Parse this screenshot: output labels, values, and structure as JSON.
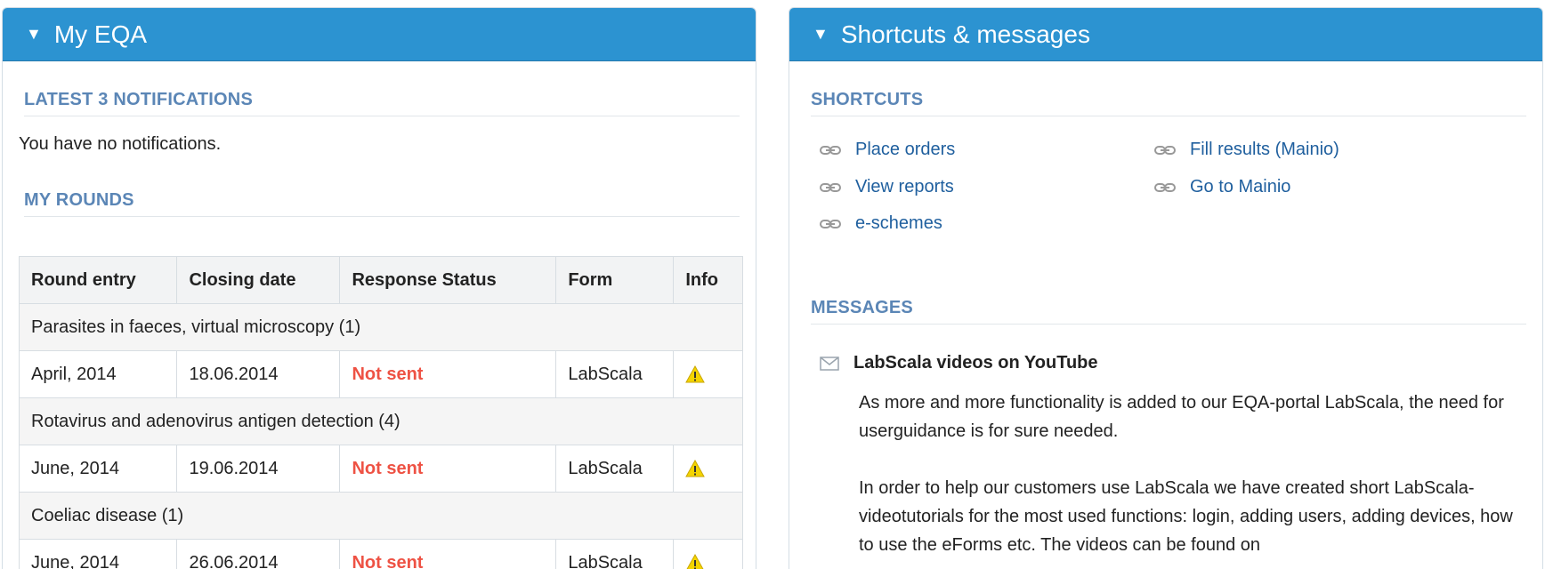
{
  "my_eqa": {
    "title": "My EQA",
    "notifications_heading": "LATEST 3 NOTIFICATIONS",
    "notifications_text": "You have no notifications.",
    "rounds_heading": "MY ROUNDS",
    "columns": [
      "Round entry",
      "Closing date",
      "Response Status",
      "Form",
      "Info"
    ],
    "groups": [
      {
        "name": "Parasites in faeces, virtual microscopy (1)",
        "round_entry": "April, 2014",
        "closing_date": "18.06.2014",
        "status": "Not sent",
        "form": "LabScala",
        "info_icon": "warning-icon"
      },
      {
        "name": "Rotavirus and adenovirus antigen detection (4)",
        "round_entry": "June, 2014",
        "closing_date": "19.06.2014",
        "status": "Not sent",
        "form": "LabScala",
        "info_icon": "warning-icon"
      },
      {
        "name": "Coeliac disease (1)",
        "round_entry": "June, 2014",
        "closing_date": "26.06.2014",
        "status": "Not sent",
        "form": "LabScala",
        "info_icon": "warning-icon"
      }
    ]
  },
  "shortcuts_panel": {
    "title": "Shortcuts & messages",
    "shortcuts_heading": "SHORTCUTS",
    "shortcuts": [
      "Place orders",
      "View reports",
      "e-schemes",
      "Fill results (Mainio)",
      "Go to Mainio"
    ],
    "messages_heading": "MESSAGES",
    "message": {
      "title": "LabScala videos on YouTube",
      "paragraph1": "As more and more functionality is added to our EQA-portal LabScala, the need for userguidance is for sure needed.",
      "paragraph2": "In order to help our customers use LabScala we have created short LabScala-videotutorials for the most used functions: login, adding users, adding devices, how to use the eForms etc. The videos can be found on"
    }
  },
  "colors": {
    "header_bg": "#2c93d1",
    "section_title": "#5b86b6",
    "link": "#1f5f9e",
    "status_not_sent": "#ee5244"
  }
}
